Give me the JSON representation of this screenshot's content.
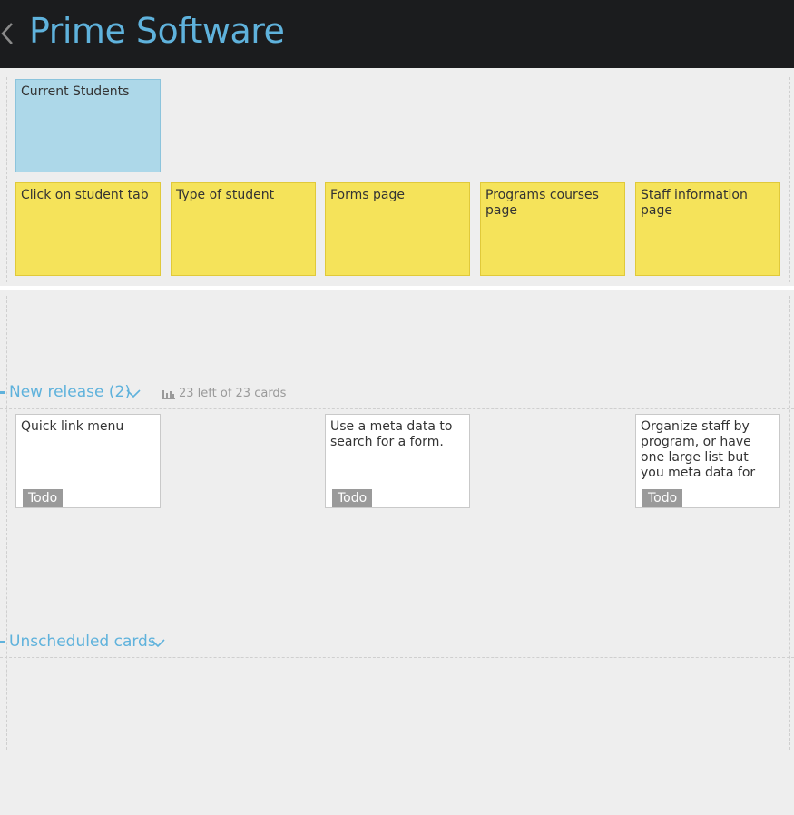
{
  "header": {
    "title": "Prime Software",
    "back_icon": "chevron-left-icon"
  },
  "top_cards": {
    "parent": "Current Students",
    "children": [
      "Click on student tab",
      "Type of student",
      "Forms page",
      "Programs courses page",
      "Staff information page"
    ]
  },
  "lanes": {
    "new_release": {
      "title": "New release (2)",
      "stats": "23 left of 23 cards",
      "cards": [
        {
          "text": "Quick link menu",
          "status": "Todo"
        },
        {
          "text": "Use a meta data to search for a form.",
          "status": "Todo"
        },
        {
          "text": "Organize staff by program, or have one large list but you meta data for",
          "status": "Todo"
        }
      ]
    },
    "unscheduled": {
      "title": "Unscheduled cards"
    }
  },
  "colors": {
    "header_bg": "#1b1c1e",
    "accent": "#5fb2dc",
    "parent_card": "#add8e9",
    "child_card": "#f5e35a",
    "todo_badge": "#9a9a9a"
  }
}
